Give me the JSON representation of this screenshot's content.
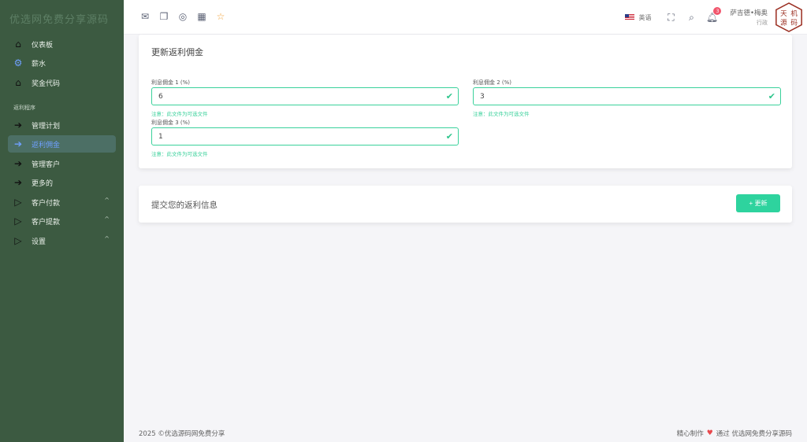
{
  "sidebar": {
    "brand": "优选网免费分享源码",
    "items": [
      {
        "label": "仪表板",
        "icon": "home-icon"
      },
      {
        "label": "薪水",
        "icon": "gear-icon"
      },
      {
        "label": "奖金代码",
        "icon": "home-icon"
      }
    ],
    "section_label": "返利程序",
    "program_items": [
      {
        "label": "管理计划",
        "icon": "arrow-right-icon"
      },
      {
        "label": "返利佣金",
        "icon": "arrow-right-icon",
        "active": true
      },
      {
        "label": "管理客户",
        "icon": "arrow-right-icon"
      },
      {
        "label": "更多的",
        "icon": "arrow-right-icon"
      },
      {
        "label": "客户付款",
        "icon": "play-icon",
        "caret": "^"
      },
      {
        "label": "客户提款",
        "icon": "play-icon",
        "caret": "^"
      },
      {
        "label": "设置",
        "icon": "play-icon",
        "caret": "^"
      }
    ]
  },
  "topbar": {
    "language": "英语",
    "notification_count": "3",
    "user_name": "萨吉德•梅奥",
    "user_role": "行政",
    "avatar_text": [
      "天",
      "机",
      "源",
      "码"
    ]
  },
  "form_card": {
    "title": "更新返利佣金",
    "fields": [
      {
        "label": "利息佣金 1 (%)",
        "value": "6",
        "hint": "注意：此文件为可选文件"
      },
      {
        "label": "利息佣金 2 (%)",
        "value": "3",
        "hint": "注意：此文件为可选文件"
      },
      {
        "label": "利息佣金 3 (%)",
        "value": "1",
        "hint": "注意：此文件为可选文件"
      }
    ]
  },
  "submit_card": {
    "title": "提交您的返利信息",
    "button": "+ 更新"
  },
  "footer": {
    "left": "2025 ©优选源码网免费分享",
    "right_prefix": "精心制作",
    "right_suffix": "通过 优选网免费分享源码"
  },
  "colors": {
    "sidebar_bg": "#3c5a41",
    "accent_green": "#2ed39e",
    "active_blue": "#6fa0ff",
    "badge_red": "#f1556c"
  }
}
